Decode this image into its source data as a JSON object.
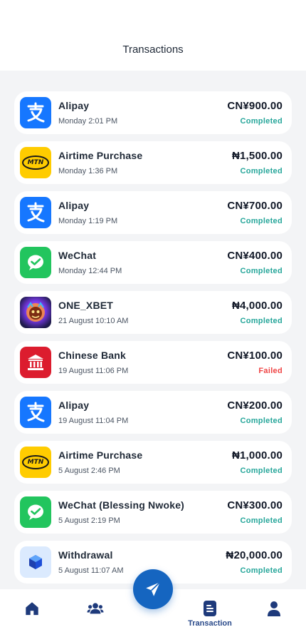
{
  "header": {
    "title": "Transactions"
  },
  "colors": {
    "completed": "#26a69a",
    "failed": "#ef4444",
    "nav": "#1e3a7b",
    "fab": "#1565c0"
  },
  "transactions": [
    {
      "icon": "alipay-icon",
      "name": "Alipay",
      "date": "Monday 2:01 PM",
      "amount": "CN¥900.00",
      "status": "Completed"
    },
    {
      "icon": "mtn-icon",
      "name": "Airtime Purchase",
      "date": "Monday 1:36 PM",
      "amount": "₦1,500.00",
      "status": "Completed",
      "mtn_text": "MTN"
    },
    {
      "icon": "alipay-icon",
      "name": "Alipay",
      "date": "Monday 1:19 PM",
      "amount": "CN¥700.00",
      "status": "Completed"
    },
    {
      "icon": "wechat-icon",
      "name": "WeChat",
      "date": "Monday 12:44 PM",
      "amount": "CN¥400.00",
      "status": "Completed"
    },
    {
      "icon": "onexbet-icon",
      "name": "ONE_XBET",
      "date": "21 August 10:10 AM",
      "amount": "₦4,000.00",
      "status": "Completed"
    },
    {
      "icon": "bank-icon",
      "name": "Chinese Bank",
      "date": "19 August 11:06 PM",
      "amount": "CN¥100.00",
      "status": "Failed"
    },
    {
      "icon": "alipay-icon",
      "name": "Alipay",
      "date": "19 August 11:04 PM",
      "amount": "CN¥200.00",
      "status": "Completed"
    },
    {
      "icon": "mtn-icon",
      "name": "Airtime Purchase",
      "date": "5 August 2:46 PM",
      "amount": "₦1,000.00",
      "status": "Completed",
      "mtn_text": "MTN"
    },
    {
      "icon": "wechat-icon",
      "name": "WeChat (Blessing Nwoke)",
      "date": "5 August 2:19 PM",
      "amount": "CN¥300.00",
      "status": "Completed"
    },
    {
      "icon": "withdrawal-icon",
      "name": "Withdrawal",
      "date": "5 August 11:07 AM",
      "amount": "₦20,000.00",
      "status": "Completed"
    }
  ],
  "nav": {
    "items": [
      {
        "id": "home",
        "icon": "home-icon"
      },
      {
        "id": "contacts",
        "icon": "users-icon"
      },
      {
        "id": "transaction",
        "icon": "document-icon",
        "label": "Transaction"
      },
      {
        "id": "profile",
        "icon": "user-icon"
      }
    ],
    "fab_icon": "send-icon"
  }
}
